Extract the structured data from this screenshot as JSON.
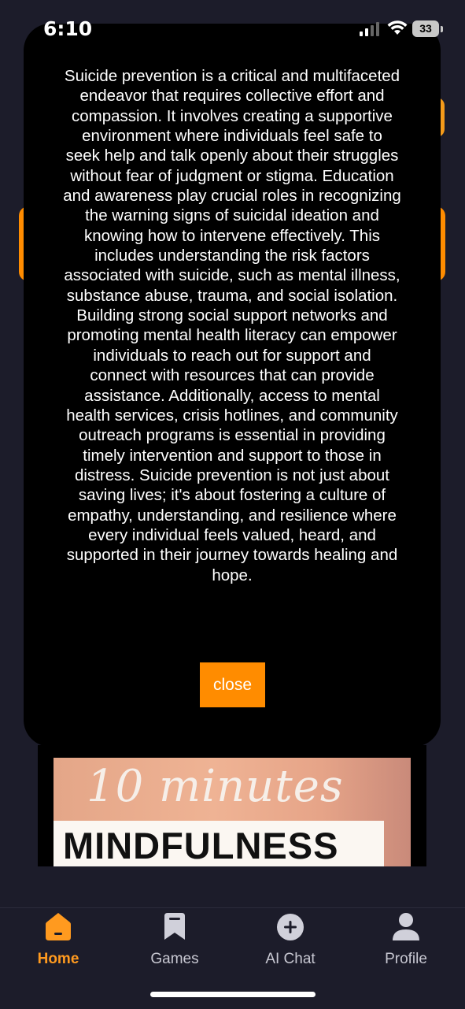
{
  "status_bar": {
    "time": "6:10",
    "battery": "33"
  },
  "modal": {
    "body": "Suicide prevention is a critical and multifaceted endeavor that requires collective effort and compassion. It involves creating a supportive environment where individuals feel safe to seek help and talk openly about their struggles without fear of judgment or stigma. Education and awareness play crucial roles in recognizing the warning signs of suicidal ideation and knowing how to intervene effectively. This includes understanding the risk factors associated with suicide, such as mental illness, substance abuse, trauma, and social isolation. Building strong social support networks and promoting mental health literacy can empower individuals to reach out for support and connect with resources that can provide assistance. Additionally, access to mental health services, crisis hotlines, and community outreach programs is essential in providing timely intervention and support to those in distress. Suicide prevention is not just about saving lives; it's about fostering a culture of empathy, understanding, and resilience where every individual feels valued, heard, and supported in their journey towards healing and hope.",
    "close_label": "close"
  },
  "thumbnail": {
    "line1": "10 minutes",
    "line2": "MINDFULNESS"
  },
  "nav": {
    "items": [
      {
        "label": "Home",
        "icon": "home-icon",
        "active": true
      },
      {
        "label": "Games",
        "icon": "bookmark-icon",
        "active": false
      },
      {
        "label": "AI Chat",
        "icon": "plus-circle-icon",
        "active": false
      },
      {
        "label": "Profile",
        "icon": "person-icon",
        "active": false
      }
    ]
  },
  "colors": {
    "accent": "#ff8c00",
    "background": "#1c1c2a",
    "modal": "#000000"
  }
}
